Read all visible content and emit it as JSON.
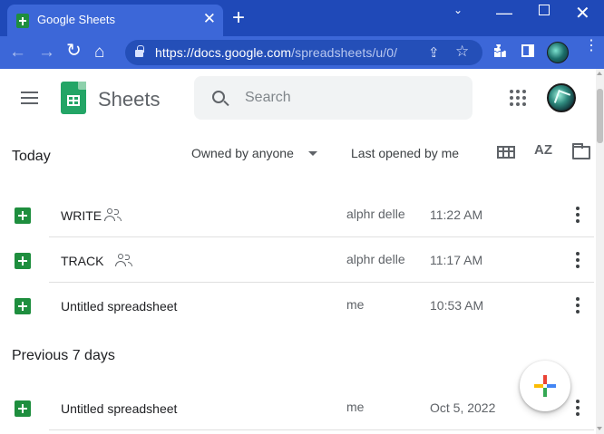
{
  "browser": {
    "tab_title": "Google Sheets",
    "tab_close": "✕",
    "new_tab": "+",
    "url_domain": "https://docs.google.com",
    "url_path": "/spreadsheets/u/0/",
    "window_controls": {
      "dropdown": "⌄",
      "minimize": "—",
      "close": "✕"
    },
    "nav": {
      "back": "←",
      "forward": "→",
      "reload": "↻",
      "home": "⌂"
    },
    "omnibox_share": "⇪",
    "omnibox_star": "☆",
    "menu": "⋮"
  },
  "app": {
    "name": "Sheets",
    "search_placeholder": "Search"
  },
  "filters": {
    "owned_by": "Owned by anyone",
    "sort": "Last opened by me",
    "sort_az": "AZ"
  },
  "sections": [
    {
      "label": "Today",
      "files": [
        {
          "name": "WRITE",
          "shared": true,
          "owner": "alphr delle",
          "time": "11:22 AM"
        },
        {
          "name": "TRACK",
          "shared": true,
          "owner": "alphr delle",
          "time": "11:17 AM"
        },
        {
          "name": "Untitled spreadsheet",
          "shared": false,
          "owner": "me",
          "time": "10:53 AM"
        }
      ]
    },
    {
      "label": "Previous 7 days",
      "files": [
        {
          "name": "Untitled spreadsheet",
          "shared": false,
          "owner": "me",
          "time": "Oct 5, 2022"
        }
      ]
    }
  ],
  "colors": {
    "chrome_titlebar": "#1f49b8",
    "chrome_toolbar": "#3c67d8",
    "sheets_green": "#1e8e3e"
  }
}
